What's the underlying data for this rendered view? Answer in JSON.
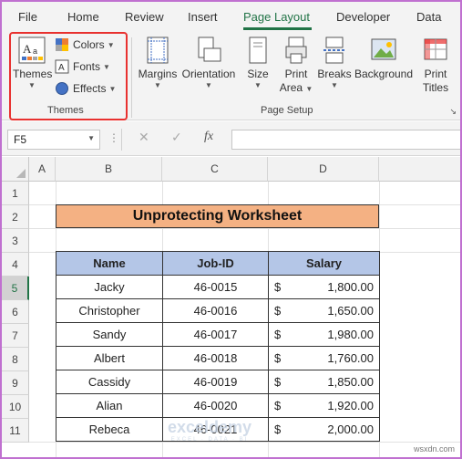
{
  "menu": {
    "tabs": [
      "File",
      "Home",
      "Review",
      "Insert",
      "Page Layout",
      "Developer",
      "Data"
    ],
    "active": "Page Layout"
  },
  "ribbon": {
    "themes_group": {
      "themes_label": "Themes",
      "colors_label": "Colors",
      "fonts_label": "Fonts",
      "effects_label": "Effects",
      "group_label": "Themes"
    },
    "page_setup_group": {
      "margins_label": "Margins",
      "orientation_label": "Orientation",
      "size_label": "Size",
      "print_area_label1": "Print",
      "print_area_label2": "Area",
      "breaks_label": "Breaks",
      "background_label": "Background",
      "print_titles_label1": "Print",
      "print_titles_label2": "Titles",
      "group_label": "Page Setup"
    }
  },
  "formula_bar": {
    "name_box": "F5",
    "fx": "fx",
    "value": ""
  },
  "sheet": {
    "columns": [
      "A",
      "B",
      "C",
      "D"
    ],
    "rows": [
      "1",
      "2",
      "3",
      "4",
      "5",
      "6",
      "7",
      "8",
      "9",
      "10",
      "11"
    ],
    "title": "Unprotecting Worksheet",
    "headers": [
      "Name",
      "Job-ID",
      "Salary"
    ],
    "records": [
      {
        "name": "Jacky",
        "job": "46-0015",
        "cur": "$",
        "salary": "1,800.00"
      },
      {
        "name": "Christopher",
        "job": "46-0016",
        "cur": "$",
        "salary": "1,650.00"
      },
      {
        "name": "Sandy",
        "job": "46-0017",
        "cur": "$",
        "salary": "1,980.00"
      },
      {
        "name": "Albert",
        "job": "46-0018",
        "cur": "$",
        "salary": "1,760.00"
      },
      {
        "name": "Cassidy",
        "job": "46-0019",
        "cur": "$",
        "salary": "1,850.00"
      },
      {
        "name": "Alian",
        "job": "46-0020",
        "cur": "$",
        "salary": "1,920.00"
      },
      {
        "name": "Rebeca",
        "job": "46-0021",
        "cur": "$",
        "salary": "2,000.00"
      }
    ]
  },
  "watermark": {
    "brand": "exceldemy",
    "tagline": "EXCEL · DATA · BI"
  },
  "site_mark": "wsxdn.com",
  "colors": {
    "accent": "#217346",
    "title_fill": "#f4b183",
    "header_fill": "#b4c6e7",
    "highlight": "#e8312f"
  }
}
